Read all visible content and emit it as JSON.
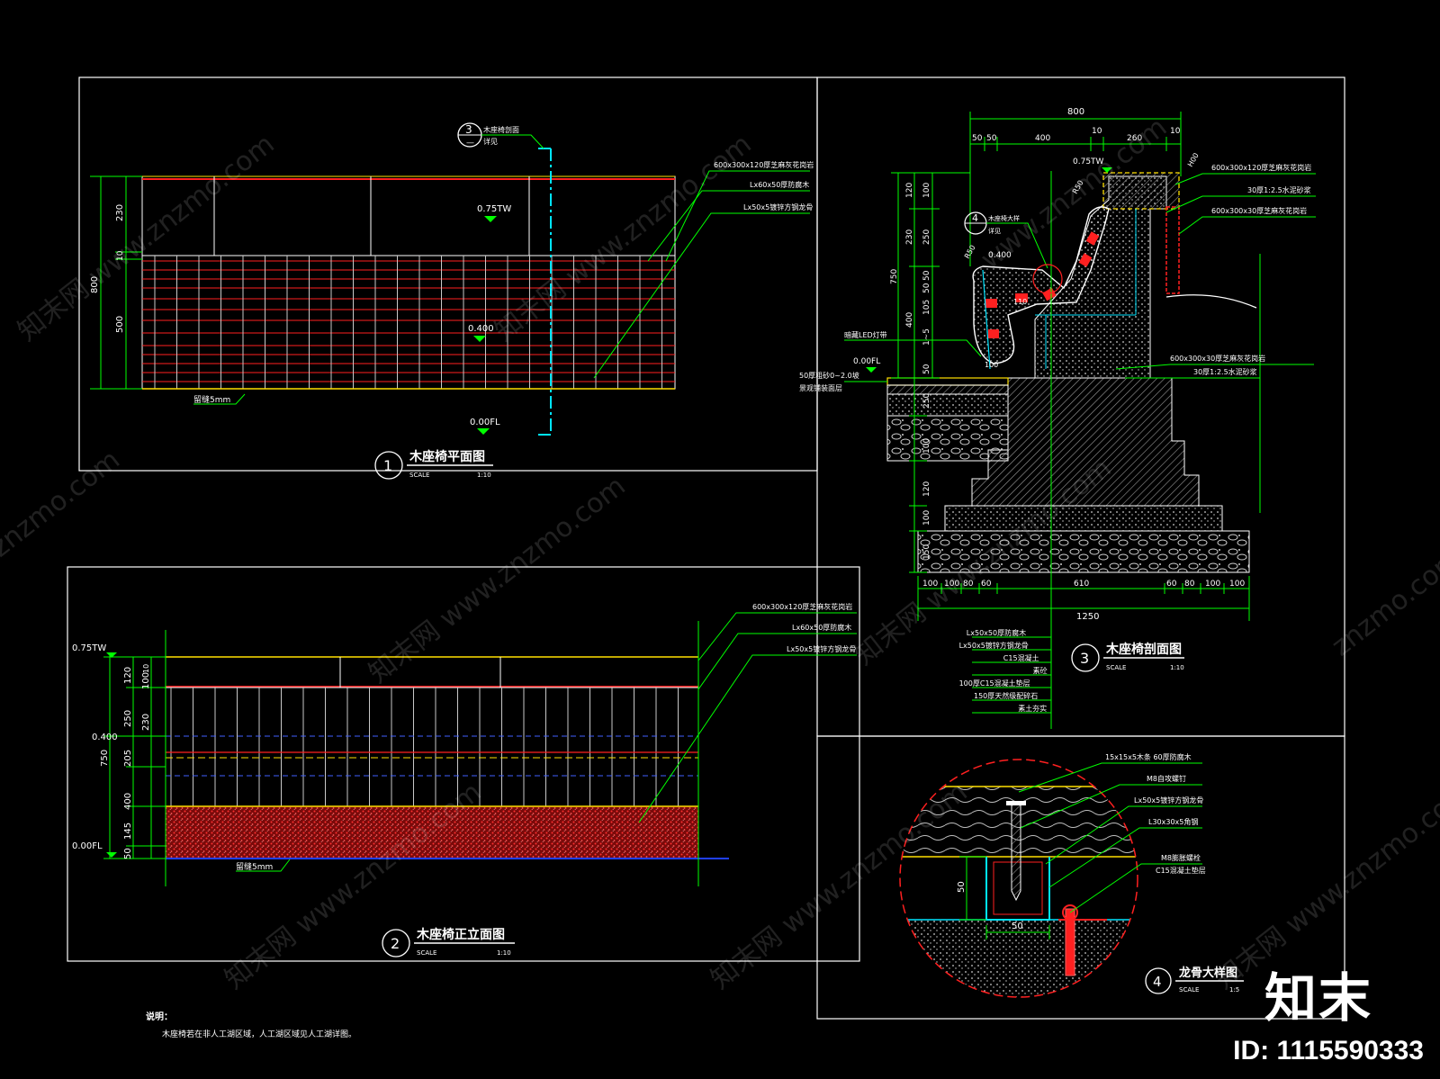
{
  "drawing": {
    "colors": {
      "bg": "#000000",
      "frame": "#ffffff",
      "dim": "#00ff00",
      "cyan": "#00e5ff",
      "red": "#ff2020",
      "yellow": "#ffe000",
      "mark": "#ffffff",
      "wm": "#d8d8d8"
    },
    "view1": {
      "title": "木座椅平面图",
      "number": "1",
      "scale_label": "SCALE",
      "scale_value": "1:10",
      "dims": [
        "230",
        "10",
        "500",
        "800"
      ],
      "levels": [
        "0.75TW",
        "0.400",
        "0.00FL"
      ],
      "gap_note": "留缝5mm",
      "section_mark": {
        "number": "3",
        "sheet": "—",
        "caption": "木座椅剖面",
        "sub": "详见"
      },
      "callouts": [
        "600x300x120厚芝麻灰花岗岩",
        "Lx60x50厚防腐木",
        "Lx50x5镀锌方钢龙骨"
      ]
    },
    "view2": {
      "title": "木座椅正立面图",
      "number": "2",
      "scale_label": "SCALE",
      "scale_value": "1:10",
      "dims_left": [
        "120",
        "250",
        "205",
        "400",
        "145",
        "50"
      ],
      "dims_inner": [
        "10",
        "100",
        "230"
      ],
      "dim_total": "750",
      "levels": [
        "0.75TW",
        "0.400",
        "0.00FL"
      ],
      "gap_note": "留缝5mm",
      "callouts": [
        "600x300x120厚芝麻灰花岗岩",
        "Lx60x50厚防腐木",
        "Lx50x5镀锌方钢龙骨"
      ]
    },
    "view3": {
      "title": "木座椅剖面图",
      "number": "3",
      "scale_label": "SCALE",
      "scale_value": "1:10",
      "dim_top": "800",
      "dims_top_sub": [
        "50",
        "50",
        "400",
        "10",
        "260",
        "10"
      ],
      "dims_left": [
        "120",
        "230",
        "400",
        "50",
        "250",
        "100",
        "120",
        "100",
        "150"
      ],
      "dims_inner": [
        "100",
        "250",
        "50",
        "50",
        "105",
        "1~5"
      ],
      "dim_total_left": "750",
      "dims_bottom": [
        "100",
        "100",
        "80",
        "60",
        "610",
        "60",
        "80",
        "100",
        "100"
      ],
      "dim_bottom_total": "1250",
      "levels": [
        "0.75TW",
        "0.400",
        "0.00FL"
      ],
      "section_mark": {
        "number": "4",
        "caption": "木座椅大样",
        "sub": "详见"
      },
      "labels": [
        "R50",
        "R50",
        "110",
        "100",
        "H00"
      ],
      "left_notes": [
        "暗藏LED灯带",
        "50厚粗砂0~2.0坡",
        "景观铺装面层"
      ],
      "right_notes": [
        "600x300x120厚芝麻灰花岗岩",
        "30厚1:2.5水泥砂浆",
        "600x300x30厚芝麻灰花岗岩",
        "600x300x30厚芝麻灰花岗岩",
        "30厚1:2.5水泥砂浆"
      ],
      "layer_notes": [
        "Lx50x50厚防腐木",
        "Lx50x5镀锌方钢龙骨",
        "C15混凝土",
        "素砼",
        "100厚C15混凝土垫层",
        "150厚天然级配碎石",
        "素土夯实"
      ]
    },
    "view4": {
      "title": "龙骨大样图",
      "number": "4",
      "scale_label": "SCALE",
      "scale_value": "1:5",
      "dims": [
        "50",
        "50"
      ],
      "callouts": [
        "15x15x5木条 60厚防腐木",
        "M8自攻螺钉",
        "Lx50x5镀锌方钢龙骨",
        "L30x30x5角钢",
        "M8膨胀螺栓",
        "C15混凝土垫层"
      ]
    },
    "notes": {
      "heading": "说明：",
      "text": "木座椅若在非人工湖区域，人工湖区域见人工湖详图。"
    },
    "watermarks": [
      "知末网 www.znzmo.com",
      "www.znzmo.com",
      "znzmo.com"
    ],
    "logo": "知末",
    "id_label": "ID: 1115590333"
  }
}
